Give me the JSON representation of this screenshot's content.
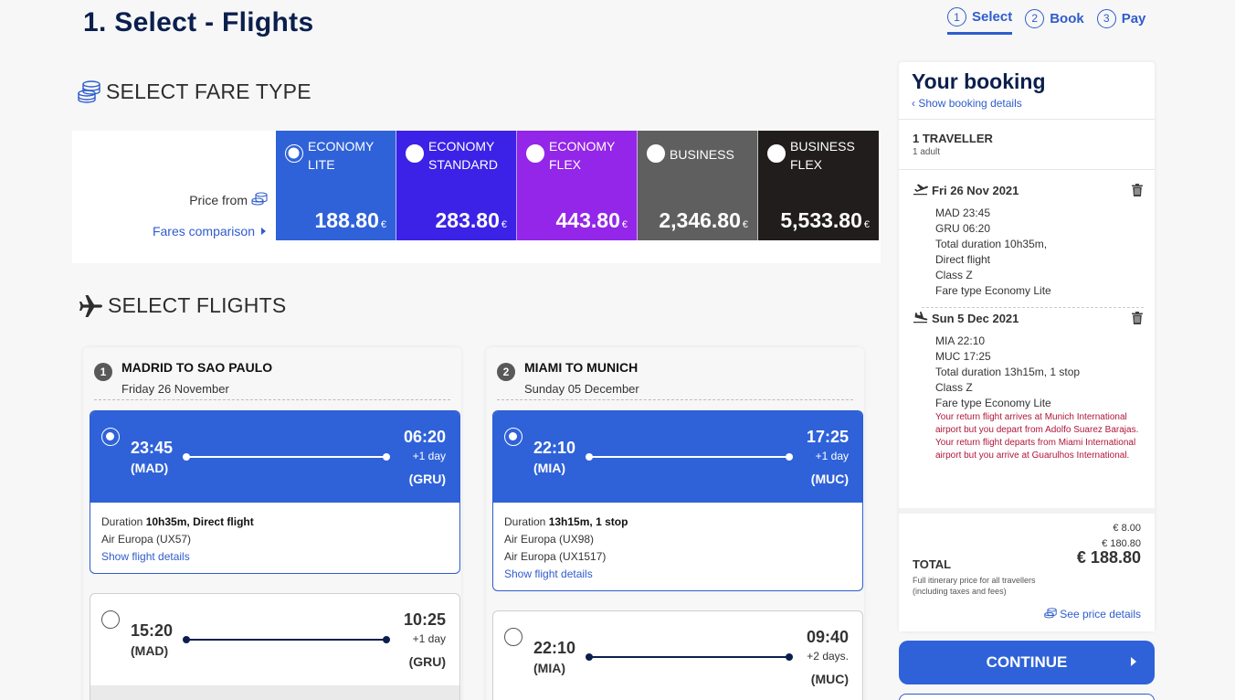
{
  "page_title": "1. Select - Flights",
  "steps": [
    {
      "num": "1",
      "label": "Select"
    },
    {
      "num": "2",
      "label": "Book"
    },
    {
      "num": "3",
      "label": "Pay"
    }
  ],
  "fare_section": {
    "title": "SELECT FARE TYPE",
    "price_from": "Price from",
    "fares_comparison": "Fares comparison",
    "fares": [
      {
        "name": "ECONOMY LITE",
        "price": "188.80",
        "currency": "€",
        "color": "#2f62d9",
        "selected": true
      },
      {
        "name": "ECONOMY STANDARD",
        "price": "283.80",
        "currency": "€",
        "color": "#3b22e6",
        "selected": false
      },
      {
        "name": "ECONOMY FLEX",
        "price": "443.80",
        "currency": "€",
        "color": "#9326e8",
        "selected": false
      },
      {
        "name": "BUSINESS",
        "price": "2,346.80",
        "currency": "€",
        "color": "#5f5f5f",
        "selected": false
      },
      {
        "name": "BUSINESS FLEX",
        "price": "5,533.80",
        "currency": "€",
        "color": "#211d1d",
        "selected": false
      }
    ]
  },
  "flights_section": {
    "title": "SELECT FLIGHTS",
    "legs": [
      {
        "num": "1",
        "route": "MADRID TO  SAO PAULO",
        "date": "Friday 26 November",
        "options": [
          {
            "dep_time": "23:45",
            "dep_code": "(MAD)",
            "arr_time": "06:20",
            "arr_plus": "+1 day",
            "arr_code": "(GRU)",
            "duration_label": "Duration",
            "duration": "10h35m",
            "stops": ", Direct flight",
            "airlines": [
              "Air Europa (UX57)"
            ],
            "details_link": "Show flight details"
          },
          {
            "dep_time": "15:20",
            "dep_code": "(MAD)",
            "arr_time": "10:25",
            "arr_plus": "+1 day",
            "arr_code": "(GRU)"
          }
        ]
      },
      {
        "num": "2",
        "route": "MIAMI TO  MUNICH",
        "date": "Sunday 05 December",
        "options": [
          {
            "dep_time": "22:10",
            "dep_code": "(MIA)",
            "arr_time": "17:25",
            "arr_plus": "+1 day",
            "arr_code": "(MUC)",
            "duration_label": "Duration",
            "duration": "13h15m",
            "stops": ", 1 stop",
            "airlines": [
              "Air Europa (UX98)",
              "Air Europa (UX1517)"
            ],
            "details_link": "Show flight details"
          },
          {
            "dep_time": "22:10",
            "dep_code": "(MIA)",
            "arr_time": "09:40",
            "arr_plus": "+2 days.",
            "arr_code": "(MUC)"
          }
        ]
      }
    ]
  },
  "booking": {
    "title": "Your booking",
    "show_details": "Show booking details",
    "travellers": "1 TRAVELLER",
    "adults": "1 adult",
    "outbound": {
      "date": "Fri 26 Nov 2021",
      "lines": [
        "MAD  23:45",
        "GRU  06:20",
        "Total duration 10h35m,",
        "Direct flight",
        "Class Z",
        "Fare type Economy Lite"
      ]
    },
    "return": {
      "date": "Sun 5 Dec 2021",
      "lines": [
        "MIA  22:10",
        "MUC  17:25",
        "Total duration 13h15m, 1 stop",
        "Class Z",
        "Fare type Economy Lite"
      ],
      "warnings": [
        "Your return flight arrives at Munich International airport but you depart from Adolfo Suarez Barajas.",
        "Your return flight departs from Miami International airport but you arrive at Guarulhos International."
      ]
    },
    "amount_1": "€  8.00",
    "amount_2": "€  180.80",
    "total_label": "TOTAL",
    "total_amount": "€ 188.80",
    "full_price_note": "Full itinerary price for all travellers (including taxes and fees)",
    "see_price_details": "See price details"
  },
  "continue_label": "CONTINUE"
}
